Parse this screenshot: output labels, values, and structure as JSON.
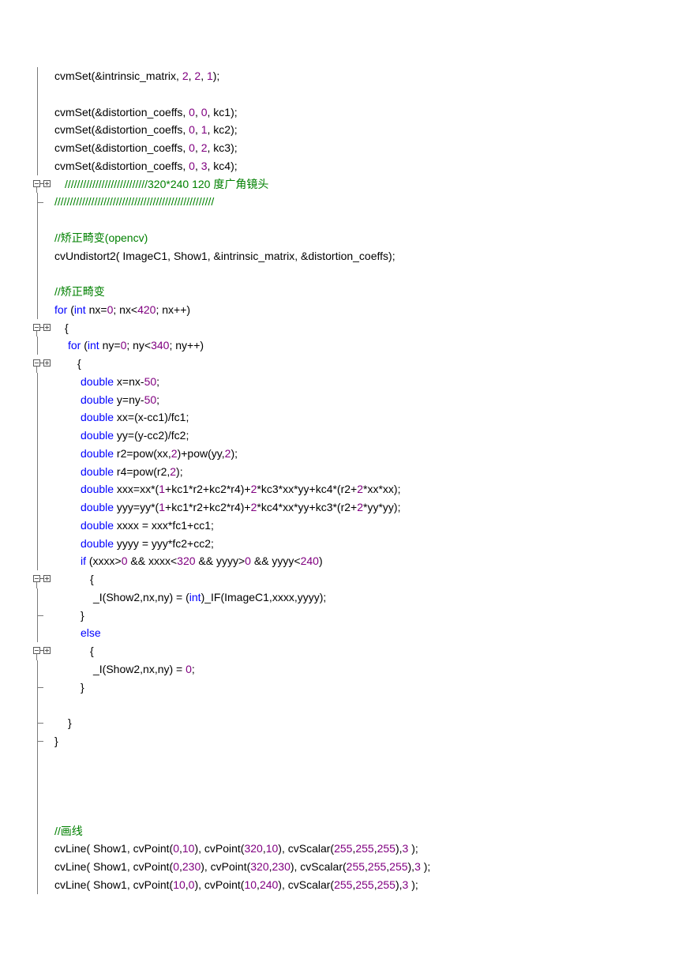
{
  "lines": [
    {
      "gutter": "bar",
      "indent": 0,
      "tokens": [
        [
          "t",
          "cvmSet(&intrinsic_matrix, "
        ],
        [
          "n",
          "2"
        ],
        [
          "t",
          ", "
        ],
        [
          "n",
          "2"
        ],
        [
          "t",
          ", "
        ],
        [
          "n",
          "1"
        ],
        [
          "t",
          ");"
        ]
      ]
    },
    {
      "gutter": "bar",
      "indent": 0,
      "tokens": []
    },
    {
      "gutter": "bar",
      "indent": 0,
      "tokens": [
        [
          "t",
          "cvmSet(&distortion_coeffs, "
        ],
        [
          "n",
          "0"
        ],
        [
          "t",
          ", "
        ],
        [
          "n",
          "0"
        ],
        [
          "t",
          ", kc1);"
        ]
      ]
    },
    {
      "gutter": "bar",
      "indent": 0,
      "tokens": [
        [
          "t",
          "cvmSet(&distortion_coeffs, "
        ],
        [
          "n",
          "0"
        ],
        [
          "t",
          ", "
        ],
        [
          "n",
          "1"
        ],
        [
          "t",
          ", kc2);"
        ]
      ]
    },
    {
      "gutter": "bar",
      "indent": 0,
      "tokens": [
        [
          "t",
          "cvmSet(&distortion_coeffs, "
        ],
        [
          "n",
          "0"
        ],
        [
          "t",
          ", "
        ],
        [
          "n",
          "2"
        ],
        [
          "t",
          ", kc3);"
        ]
      ]
    },
    {
      "gutter": "bar",
      "indent": 0,
      "tokens": [
        [
          "t",
          "cvmSet(&distortion_coeffs, "
        ],
        [
          "n",
          "0"
        ],
        [
          "t",
          ", "
        ],
        [
          "n",
          "3"
        ],
        [
          "t",
          ", kc4);"
        ]
      ]
    },
    {
      "gutter": "fold",
      "indent": 1,
      "tokens": [
        [
          "c",
          "///////////////////////////320*240 120 度广角镜头"
        ]
      ]
    },
    {
      "gutter": "end",
      "indent": 0,
      "tokens": [
        [
          "c",
          "////////////////////////////////////////////////////"
        ]
      ]
    },
    {
      "gutter": "bar",
      "indent": 0,
      "tokens": []
    },
    {
      "gutter": "bar",
      "indent": 0,
      "tokens": [
        [
          "c",
          "//矫正畸变(opencv)"
        ]
      ]
    },
    {
      "gutter": "bar",
      "indent": 0,
      "tokens": [
        [
          "t",
          "cvUndistort2( ImageC1, Show1, &intrinsic_matrix, &distortion_coeffs);"
        ]
      ]
    },
    {
      "gutter": "bar",
      "indent": 0,
      "tokens": []
    },
    {
      "gutter": "bar",
      "indent": 0,
      "tokens": [
        [
          "c",
          "//矫正畸变"
        ]
      ]
    },
    {
      "gutter": "bar",
      "indent": 0,
      "tokens": [
        [
          "k",
          "for"
        ],
        [
          "t",
          " ("
        ],
        [
          "k",
          "int"
        ],
        [
          "t",
          " nx="
        ],
        [
          "n",
          "0"
        ],
        [
          "t",
          "; nx<"
        ],
        [
          "n",
          "420"
        ],
        [
          "t",
          "; nx++)"
        ]
      ]
    },
    {
      "gutter": "fold",
      "indent": 1,
      "tokens": [
        [
          "t",
          "{"
        ]
      ]
    },
    {
      "gutter": "bar",
      "indent": 2,
      "tokens": [
        [
          "k",
          "for"
        ],
        [
          "t",
          " ("
        ],
        [
          "k",
          "int"
        ],
        [
          "t",
          " ny="
        ],
        [
          "n",
          "0"
        ],
        [
          "t",
          "; ny<"
        ],
        [
          "n",
          "340"
        ],
        [
          "t",
          "; ny++)"
        ]
      ]
    },
    {
      "gutter": "fold",
      "indent": 3,
      "tokens": [
        [
          "t",
          "{"
        ]
      ]
    },
    {
      "gutter": "bar",
      "indent": 4,
      "tokens": [
        [
          "k",
          "double"
        ],
        [
          "t",
          " x=nx-"
        ],
        [
          "n",
          "50"
        ],
        [
          "t",
          ";"
        ]
      ]
    },
    {
      "gutter": "bar",
      "indent": 4,
      "tokens": [
        [
          "k",
          "double"
        ],
        [
          "t",
          " y=ny-"
        ],
        [
          "n",
          "50"
        ],
        [
          "t",
          ";"
        ]
      ]
    },
    {
      "gutter": "bar",
      "indent": 4,
      "tokens": [
        [
          "k",
          "double"
        ],
        [
          "t",
          " xx=(x-cc1)/fc1;"
        ]
      ]
    },
    {
      "gutter": "bar",
      "indent": 4,
      "tokens": [
        [
          "k",
          "double"
        ],
        [
          "t",
          " yy=(y-cc2)/fc2;"
        ]
      ]
    },
    {
      "gutter": "bar",
      "indent": 4,
      "tokens": [
        [
          "k",
          "double"
        ],
        [
          "t",
          " r2=pow(xx,"
        ],
        [
          "n",
          "2"
        ],
        [
          "t",
          ")+pow(yy,"
        ],
        [
          "n",
          "2"
        ],
        [
          "t",
          ");"
        ]
      ]
    },
    {
      "gutter": "bar",
      "indent": 4,
      "tokens": [
        [
          "k",
          "double"
        ],
        [
          "t",
          " r4=pow(r2,"
        ],
        [
          "n",
          "2"
        ],
        [
          "t",
          ");"
        ]
      ]
    },
    {
      "gutter": "bar",
      "indent": 4,
      "tokens": [
        [
          "k",
          "double"
        ],
        [
          "t",
          " xxx=xx*("
        ],
        [
          "n",
          "1"
        ],
        [
          "t",
          "+kc1*r2+kc2*r4)+"
        ],
        [
          "n",
          "2"
        ],
        [
          "t",
          "*kc3*xx*yy+kc4*(r2+"
        ],
        [
          "n",
          "2"
        ],
        [
          "t",
          "*xx*xx);"
        ]
      ]
    },
    {
      "gutter": "bar",
      "indent": 4,
      "tokens": [
        [
          "k",
          "double"
        ],
        [
          "t",
          " yyy=yy*("
        ],
        [
          "n",
          "1"
        ],
        [
          "t",
          "+kc1*r2+kc2*r4)+"
        ],
        [
          "n",
          "2"
        ],
        [
          "t",
          "*kc4*xx*yy+kc3*(r2+"
        ],
        [
          "n",
          "2"
        ],
        [
          "t",
          "*yy*yy);"
        ]
      ]
    },
    {
      "gutter": "bar",
      "indent": 4,
      "tokens": [
        [
          "k",
          "double"
        ],
        [
          "t",
          " xxxx = xxx*fc1+cc1;"
        ]
      ]
    },
    {
      "gutter": "bar",
      "indent": 4,
      "tokens": [
        [
          "k",
          "double"
        ],
        [
          "t",
          " yyyy = yyy*fc2+cc2;"
        ]
      ]
    },
    {
      "gutter": "bar",
      "indent": 4,
      "tokens": [
        [
          "k",
          "if"
        ],
        [
          "t",
          " (xxxx>"
        ],
        [
          "n",
          "0"
        ],
        [
          "t",
          " && xxxx<"
        ],
        [
          "n",
          "320"
        ],
        [
          "t",
          " && yyyy>"
        ],
        [
          "n",
          "0"
        ],
        [
          "t",
          " && yyyy<"
        ],
        [
          "n",
          "240"
        ],
        [
          "t",
          ")"
        ]
      ]
    },
    {
      "gutter": "fold",
      "indent": 5,
      "tokens": [
        [
          "t",
          "{"
        ]
      ]
    },
    {
      "gutter": "bar",
      "indent": 6,
      "tokens": [
        [
          "t",
          "_I(Show2,nx,ny) = ("
        ],
        [
          "k",
          "int"
        ],
        [
          "t",
          ")_IF(ImageC1,xxxx,yyyy);"
        ]
      ]
    },
    {
      "gutter": "end",
      "indent": 4,
      "tokens": [
        [
          "t",
          "}"
        ]
      ]
    },
    {
      "gutter": "bar",
      "indent": 4,
      "tokens": [
        [
          "k",
          "else"
        ]
      ]
    },
    {
      "gutter": "fold",
      "indent": 5,
      "tokens": [
        [
          "t",
          "{"
        ]
      ]
    },
    {
      "gutter": "bar",
      "indent": 6,
      "tokens": [
        [
          "t",
          "_I(Show2,nx,ny) = "
        ],
        [
          "n",
          "0"
        ],
        [
          "t",
          ";"
        ]
      ]
    },
    {
      "gutter": "end",
      "indent": 4,
      "tokens": [
        [
          "t",
          "}"
        ]
      ]
    },
    {
      "gutter": "bar",
      "indent": 0,
      "tokens": []
    },
    {
      "gutter": "end",
      "indent": 2,
      "tokens": [
        [
          "t",
          "}"
        ]
      ]
    },
    {
      "gutter": "end",
      "indent": 0,
      "tokens": [
        [
          "t",
          "}"
        ]
      ]
    },
    {
      "gutter": "bar",
      "indent": 0,
      "tokens": []
    },
    {
      "gutter": "bar",
      "indent": 0,
      "tokens": []
    },
    {
      "gutter": "bar",
      "indent": 0,
      "tokens": []
    },
    {
      "gutter": "bar",
      "indent": 0,
      "tokens": []
    },
    {
      "gutter": "bar",
      "indent": 0,
      "tokens": [
        [
          "c",
          "//画线"
        ]
      ]
    },
    {
      "gutter": "bar",
      "indent": 0,
      "tokens": [
        [
          "t",
          "cvLine( Show1, cvPoint("
        ],
        [
          "n",
          "0"
        ],
        [
          "t",
          ","
        ],
        [
          "n",
          "10"
        ],
        [
          "t",
          "), cvPoint("
        ],
        [
          "n",
          "320"
        ],
        [
          "t",
          ","
        ],
        [
          "n",
          "10"
        ],
        [
          "t",
          "), cvScalar("
        ],
        [
          "n",
          "255"
        ],
        [
          "t",
          ","
        ],
        [
          "n",
          "255"
        ],
        [
          "t",
          ","
        ],
        [
          "n",
          "255"
        ],
        [
          "t",
          "),"
        ],
        [
          "n",
          "3"
        ],
        [
          "t",
          " );"
        ]
      ]
    },
    {
      "gutter": "bar",
      "indent": 0,
      "tokens": [
        [
          "t",
          "cvLine( Show1, cvPoint("
        ],
        [
          "n",
          "0"
        ],
        [
          "t",
          ","
        ],
        [
          "n",
          "230"
        ],
        [
          "t",
          "), cvPoint("
        ],
        [
          "n",
          "320"
        ],
        [
          "t",
          ","
        ],
        [
          "n",
          "230"
        ],
        [
          "t",
          "), cvScalar("
        ],
        [
          "n",
          "255"
        ],
        [
          "t",
          ","
        ],
        [
          "n",
          "255"
        ],
        [
          "t",
          ","
        ],
        [
          "n",
          "255"
        ],
        [
          "t",
          "),"
        ],
        [
          "n",
          "3"
        ],
        [
          "t",
          " );"
        ]
      ]
    },
    {
      "gutter": "bar",
      "indent": 0,
      "tokens": [
        [
          "t",
          "cvLine( Show1, cvPoint("
        ],
        [
          "n",
          "10"
        ],
        [
          "t",
          ","
        ],
        [
          "n",
          "0"
        ],
        [
          "t",
          "), cvPoint("
        ],
        [
          "n",
          "10"
        ],
        [
          "t",
          ","
        ],
        [
          "n",
          "240"
        ],
        [
          "t",
          "), cvScalar("
        ],
        [
          "n",
          "255"
        ],
        [
          "t",
          ","
        ],
        [
          "n",
          "255"
        ],
        [
          "t",
          ","
        ],
        [
          "n",
          "255"
        ],
        [
          "t",
          "),"
        ],
        [
          "n",
          "3"
        ],
        [
          "t",
          " );"
        ]
      ]
    }
  ]
}
